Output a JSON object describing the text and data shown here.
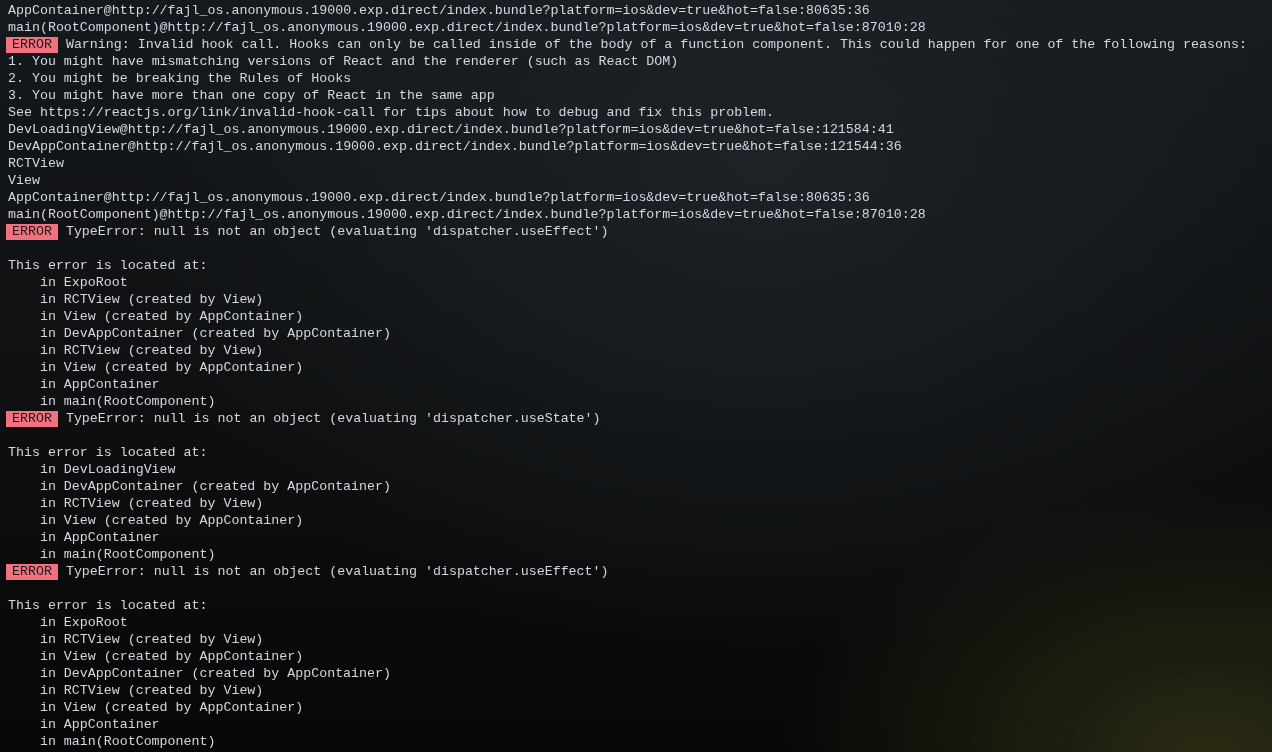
{
  "terminal": {
    "lines": [
      {
        "kind": "text",
        "text": "AppContainer@http://fajl_os.anonymous.19000.exp.direct/index.bundle?platform=ios&dev=true&hot=false:80635:36"
      },
      {
        "kind": "text",
        "text": "main(RootComponent)@http://fajl_os.anonymous.19000.exp.direct/index.bundle?platform=ios&dev=true&hot=false:87010:28"
      },
      {
        "kind": "error",
        "badge": "ERROR",
        "text": "Warning: Invalid hook call. Hooks can only be called inside of the body of a function component. This could happen for one of the following reasons:"
      },
      {
        "kind": "text",
        "text": "1. You might have mismatching versions of React and the renderer (such as React DOM)"
      },
      {
        "kind": "text",
        "text": "2. You might be breaking the Rules of Hooks"
      },
      {
        "kind": "text",
        "text": "3. You might have more than one copy of React in the same app"
      },
      {
        "kind": "text",
        "text": "See https://reactjs.org/link/invalid-hook-call for tips about how to debug and fix this problem."
      },
      {
        "kind": "text",
        "text": "DevLoadingView@http://fajl_os.anonymous.19000.exp.direct/index.bundle?platform=ios&dev=true&hot=false:121584:41"
      },
      {
        "kind": "text",
        "text": "DevAppContainer@http://fajl_os.anonymous.19000.exp.direct/index.bundle?platform=ios&dev=true&hot=false:121544:36"
      },
      {
        "kind": "text",
        "text": "RCTView"
      },
      {
        "kind": "text",
        "text": "View"
      },
      {
        "kind": "text",
        "text": "AppContainer@http://fajl_os.anonymous.19000.exp.direct/index.bundle?platform=ios&dev=true&hot=false:80635:36"
      },
      {
        "kind": "text",
        "text": "main(RootComponent)@http://fajl_os.anonymous.19000.exp.direct/index.bundle?platform=ios&dev=true&hot=false:87010:28"
      },
      {
        "kind": "error",
        "badge": "ERROR",
        "text": "TypeError: null is not an object (evaluating 'dispatcher.useEffect')"
      },
      {
        "kind": "blank"
      },
      {
        "kind": "text",
        "text": "This error is located at:"
      },
      {
        "kind": "frame",
        "text": "in ExpoRoot"
      },
      {
        "kind": "frame",
        "text": "in RCTView (created by View)"
      },
      {
        "kind": "frame",
        "text": "in View (created by AppContainer)"
      },
      {
        "kind": "frame",
        "text": "in DevAppContainer (created by AppContainer)"
      },
      {
        "kind": "frame",
        "text": "in RCTView (created by View)"
      },
      {
        "kind": "frame",
        "text": "in View (created by AppContainer)"
      },
      {
        "kind": "frame",
        "text": "in AppContainer"
      },
      {
        "kind": "frame",
        "text": "in main(RootComponent)"
      },
      {
        "kind": "error",
        "badge": "ERROR",
        "text": "TypeError: null is not an object (evaluating 'dispatcher.useState')"
      },
      {
        "kind": "blank"
      },
      {
        "kind": "text",
        "text": "This error is located at:"
      },
      {
        "kind": "frame",
        "text": "in DevLoadingView"
      },
      {
        "kind": "frame",
        "text": "in DevAppContainer (created by AppContainer)"
      },
      {
        "kind": "frame",
        "text": "in RCTView (created by View)"
      },
      {
        "kind": "frame",
        "text": "in View (created by AppContainer)"
      },
      {
        "kind": "frame",
        "text": "in AppContainer"
      },
      {
        "kind": "frame",
        "text": "in main(RootComponent)"
      },
      {
        "kind": "error",
        "badge": "ERROR",
        "text": "TypeError: null is not an object (evaluating 'dispatcher.useEffect')"
      },
      {
        "kind": "blank"
      },
      {
        "kind": "text",
        "text": "This error is located at:"
      },
      {
        "kind": "frame",
        "text": "in ExpoRoot"
      },
      {
        "kind": "frame",
        "text": "in RCTView (created by View)"
      },
      {
        "kind": "frame",
        "text": "in View (created by AppContainer)"
      },
      {
        "kind": "frame",
        "text": "in DevAppContainer (created by AppContainer)"
      },
      {
        "kind": "frame",
        "text": "in RCTView (created by View)"
      },
      {
        "kind": "frame",
        "text": "in View (created by AppContainer)"
      },
      {
        "kind": "frame",
        "text": "in AppContainer"
      },
      {
        "kind": "frame",
        "text": "in main(RootComponent)"
      }
    ]
  }
}
